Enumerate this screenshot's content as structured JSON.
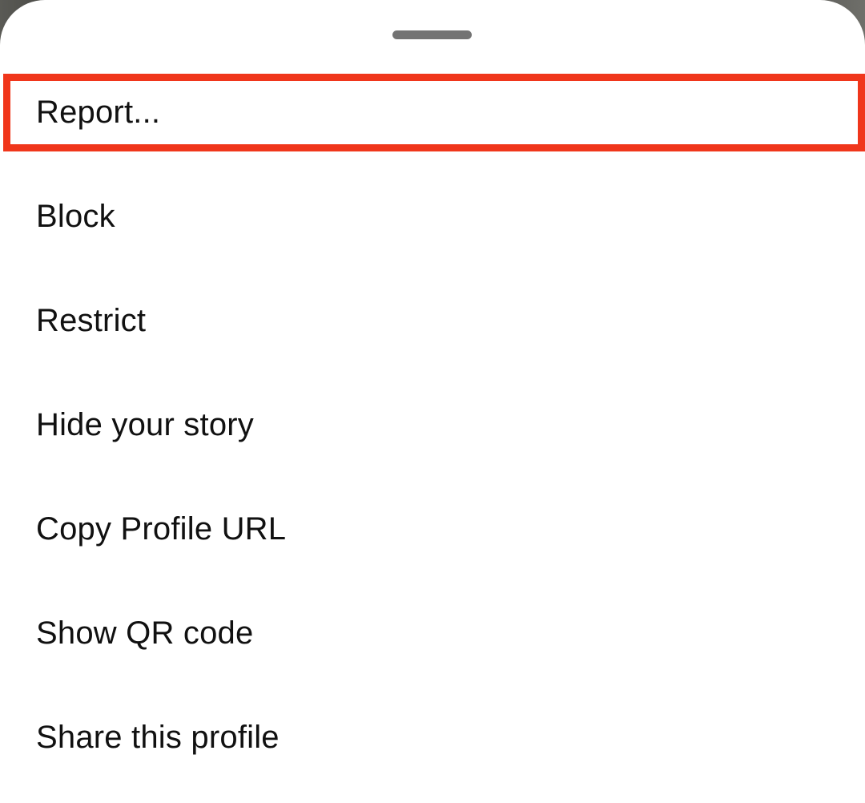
{
  "sheet": {
    "menu_items": [
      {
        "label": "Report..."
      },
      {
        "label": "Block"
      },
      {
        "label": "Restrict"
      },
      {
        "label": "Hide your story"
      },
      {
        "label": "Copy Profile URL"
      },
      {
        "label": "Show QR code"
      },
      {
        "label": "Share this profile"
      }
    ]
  },
  "colors": {
    "highlight": "#f0361b",
    "sheet_background": "#ffffff",
    "text": "#111111",
    "handle": "#737373"
  }
}
